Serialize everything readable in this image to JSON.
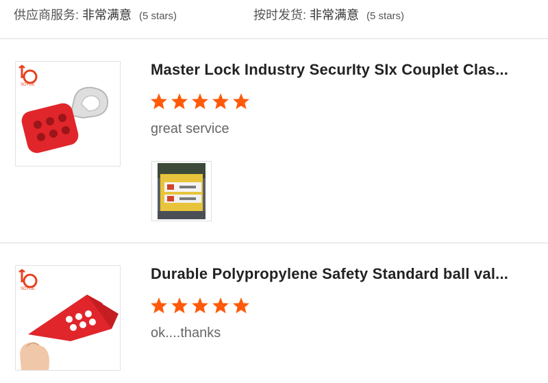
{
  "ratings": [
    {
      "label": "供应商服务:",
      "value": "非常满意",
      "stars": "(5 stars)"
    },
    {
      "label": "按时发货:",
      "value": "非常满意",
      "stars": "(5 stars)"
    }
  ],
  "reviews": [
    {
      "title": "Master Lock Industry SecurIty SIx Couplet Clas...",
      "rating": 5,
      "comment": "great service",
      "thumbnail_icon": "red-lockout-hasp-image",
      "has_photo": true
    },
    {
      "title": "Durable Polypropylene Safety Standard ball val...",
      "rating": 5,
      "comment": "ok....thanks",
      "thumbnail_icon": "red-ball-valve-lockout-image",
      "has_photo": false
    }
  ],
  "colors": {
    "star": "#ff5a0a",
    "brand": "#e8401c",
    "product_red": "#e0262b",
    "divider": "#dcdcdc"
  }
}
